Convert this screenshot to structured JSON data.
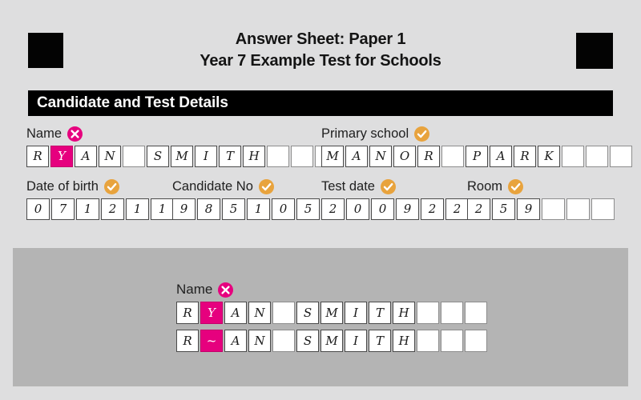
{
  "sheet": {
    "background_color": "#dededf",
    "title_lines": [
      "Answer Sheet: Paper 1",
      "Year 7 Example Test for Schools"
    ],
    "section_header": "Candidate and Test Details"
  },
  "colors": {
    "cross_badge": "#e6007e",
    "tick_badge": "#e8a33d",
    "highlight_cell": "#e6007e",
    "section_bar": "#000000",
    "panel": "#b4b4b4",
    "page": "#dededf"
  },
  "fields": {
    "name": {
      "label": "Name",
      "status": "cross",
      "status_icon": "cross-icon",
      "cells": [
        "R",
        "Y",
        "A",
        "N",
        "",
        "S",
        "M",
        "I",
        "T",
        "H",
        "",
        "",
        ""
      ],
      "highlight_index": 1
    },
    "primary_school": {
      "label": "Primary school",
      "status": "tick",
      "status_icon": "check-icon",
      "cells": [
        "M",
        "A",
        "N",
        "O",
        "R",
        "",
        "P",
        "A",
        "R",
        "K",
        "",
        "",
        ""
      ],
      "highlight_index": -1
    },
    "date_of_birth": {
      "label": "Date of birth",
      "status": "tick",
      "status_icon": "check-icon",
      "cells": [
        "0",
        "7",
        "1",
        "2",
        "1",
        "1"
      ],
      "highlight_index": -1
    },
    "candidate_no": {
      "label": "Candidate No",
      "status": "tick",
      "status_icon": "check-icon",
      "cells": [
        "9",
        "8",
        "5",
        "1",
        "0",
        "5"
      ],
      "highlight_index": -1
    },
    "test_date": {
      "label": "Test date",
      "status": "tick",
      "status_icon": "check-icon",
      "cells": [
        "2",
        "0",
        "0",
        "9",
        "2",
        "2"
      ],
      "highlight_index": -1
    },
    "room": {
      "label": "Room",
      "status": "tick",
      "status_icon": "check-icon",
      "cells": [
        "2",
        "5",
        "9",
        "",
        "",
        ""
      ],
      "highlight_index": -1
    }
  },
  "panel": {
    "name": {
      "label": "Name",
      "status": "cross",
      "status_icon": "cross-icon",
      "rows": [
        {
          "cells": [
            "R",
            "Y",
            "A",
            "N",
            "",
            "S",
            "M",
            "I",
            "T",
            "H",
            "",
            "",
            ""
          ],
          "highlight_index": 1
        },
        {
          "cells": [
            "R",
            "~",
            "A",
            "N",
            "",
            "S",
            "M",
            "I",
            "T",
            "H",
            "",
            "",
            ""
          ],
          "highlight_index": 1
        }
      ]
    }
  }
}
